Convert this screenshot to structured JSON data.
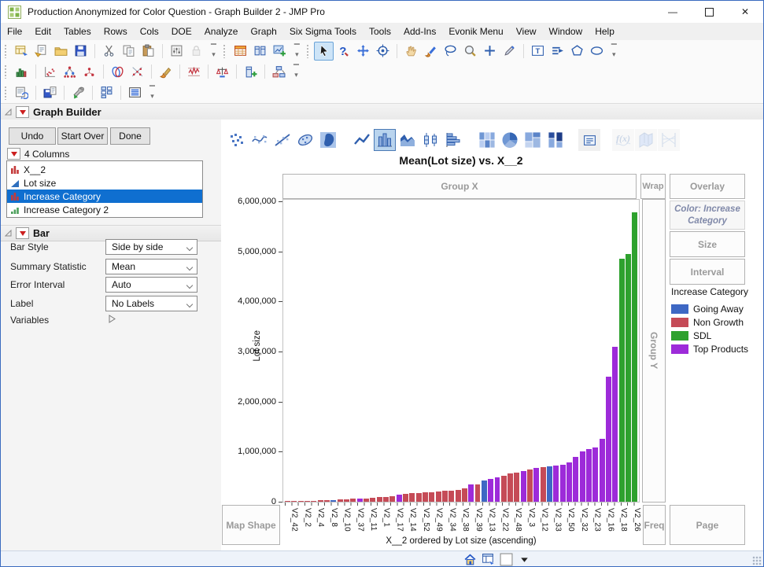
{
  "window": {
    "title": "Production Anonymized for Color Question - Graph Builder 2 - JMP Pro",
    "app_icon": "jmp-logo-icon"
  },
  "menu": {
    "items": [
      "File",
      "Edit",
      "Tables",
      "Rows",
      "Cols",
      "DOE",
      "Analyze",
      "Graph",
      "Six Sigma Tools",
      "Tools",
      "Add-Ins",
      "Evonik Menu",
      "View",
      "Window",
      "Help"
    ]
  },
  "toolbars": {
    "row1": [
      {
        "groups": [
          [
            "new-window",
            "open-script",
            "open-folder",
            "save"
          ],
          [
            "cut",
            "copy",
            "paste"
          ],
          [
            "preferences",
            "lock-disabled"
          ]
        ],
        "overflow": true
      },
      {
        "groups": [
          [
            "data-table",
            "columns",
            "new-graph"
          ]
        ],
        "overflow": true
      },
      {
        "groups": [
          [
            "cursor-selected",
            "help",
            "move",
            "target"
          ],
          [
            "hand",
            "brush",
            "lasso",
            "zoom",
            "crosshair",
            "annotate"
          ],
          [
            "text-box",
            "arrow-lines",
            "polygon",
            "oval"
          ]
        ],
        "overflow": true
      }
    ],
    "row2": [
      {
        "groups": [
          [
            "distribution"
          ],
          [
            "fit-y-by-x",
            "hierarchical-cluster",
            "cluster"
          ],
          [
            "matched-pairs",
            "fit-model"
          ],
          [
            "screening"
          ],
          [
            "control-chart"
          ],
          [
            "variability"
          ],
          [
            "cols-add"
          ],
          [
            "partition"
          ]
        ],
        "overflow": true
      }
    ],
    "row3": [
      {
        "groups": [
          [
            "data-refresh"
          ],
          [
            "save-session"
          ],
          [
            "run-tools"
          ],
          [
            "journal"
          ],
          [
            "layout-view"
          ]
        ],
        "overflow": true
      }
    ]
  },
  "graph_builder": {
    "outline_title": "Graph Builder",
    "buttons": [
      "Undo",
      "Start Over",
      "Done"
    ],
    "columns_header": "4 Columns",
    "columns": [
      {
        "label": "X__2",
        "icon": "red-bars-icon",
        "selected": false
      },
      {
        "label": "Lot size",
        "icon": "blue-triangle-icon",
        "selected": false
      },
      {
        "label": "Increase Category",
        "icon": "red-bars-icon",
        "selected": true
      },
      {
        "label": "Increase Category 2",
        "icon": "green-bars-icon",
        "selected": false
      }
    ],
    "bar_panel": {
      "title": "Bar",
      "rows": [
        {
          "label": "Bar Style",
          "value": "Side by side"
        },
        {
          "label": "Summary Statistic",
          "value": "Mean"
        },
        {
          "label": "Error Interval",
          "value": "Auto"
        },
        {
          "label": "Label",
          "value": "No Labels"
        }
      ],
      "variables_label": "Variables"
    },
    "palette": {
      "groups": [
        [
          "points",
          "smoother",
          "line-of-fit",
          "ellipse",
          "contour"
        ],
        [
          "line",
          "bar-selected",
          "area",
          "box-plot",
          "histogram"
        ],
        [
          "heatmap",
          "pie",
          "treemap",
          "mosaic"
        ],
        [
          "caption-box"
        ],
        [
          "formula-disabled",
          "map-shape-disabled",
          "parallel-disabled"
        ]
      ]
    }
  },
  "chart": {
    "title": "Mean(Lot size) vs. X__2",
    "zones": {
      "group_x": "Group X",
      "wrap": "Wrap",
      "overlay": "Overlay",
      "color": "Color: Increase Category",
      "size": "Size",
      "interval": "Interval",
      "group_y": "Group Y",
      "map_shape": "Map Shape",
      "freq": "Freq",
      "page": "Page"
    },
    "legend": {
      "title": "Increase Category",
      "items": [
        {
          "label": "Going Away",
          "color": "#3E68C4"
        },
        {
          "label": "Non Growth",
          "color": "#C54B57"
        },
        {
          "label": "SDL",
          "color": "#2EA12E"
        },
        {
          "label": "Top Products",
          "color": "#9D2BD9"
        }
      ]
    }
  },
  "chart_data": {
    "type": "bar",
    "title": "Mean(Lot size) vs. X__2",
    "xlabel": "X__2 ordered by Lot size (ascending)",
    "ylabel": "Lot size",
    "ylim": [
      0,
      6000000
    ],
    "grid": false,
    "legend_position": "right",
    "yticks": [
      0,
      1000000,
      2000000,
      3000000,
      4000000,
      5000000,
      6000000
    ],
    "ytick_labels": [
      "0",
      "1,000,000",
      "2,000,000",
      "3,000,000",
      "4,000,000",
      "5,000,000",
      "6,000,000"
    ],
    "x_tick_labels": [
      "V2_42",
      "V2_2",
      "V2_4",
      "V2_8",
      "V2_10",
      "V2_37",
      "V2_11",
      "V2_1",
      "V2_17",
      "V2_14",
      "V2_52",
      "V2_49",
      "V2_34",
      "V2_38",
      "V2_39",
      "V2_13",
      "V2_22",
      "V2_48",
      "V2_3",
      "V2_12",
      "V2_33",
      "V2_50",
      "V2_32",
      "V2_23",
      "V2_16",
      "V2_18",
      "V2_26"
    ],
    "category_colors": {
      "GA": "#3E68C4",
      "NG": "#C54B57",
      "SDL": "#2EA12E",
      "TP": "#9D2BD9"
    },
    "category_names": {
      "GA": "Going Away",
      "NG": "Non Growth",
      "SDL": "SDL",
      "TP": "Top Products"
    },
    "bars": [
      {
        "v": 8000,
        "c": "NG"
      },
      {
        "v": 10000,
        "c": "NG"
      },
      {
        "v": 13000,
        "c": "NG"
      },
      {
        "v": 16000,
        "c": "NG"
      },
      {
        "v": 20000,
        "c": "NG"
      },
      {
        "v": 24000,
        "c": "NG"
      },
      {
        "v": 30000,
        "c": "NG"
      },
      {
        "v": 38000,
        "c": "GA"
      },
      {
        "v": 42000,
        "c": "NG"
      },
      {
        "v": 48000,
        "c": "NG"
      },
      {
        "v": 55000,
        "c": "NG"
      },
      {
        "v": 62000,
        "c": "TP"
      },
      {
        "v": 70000,
        "c": "NG"
      },
      {
        "v": 80000,
        "c": "NG"
      },
      {
        "v": 90000,
        "c": "NG"
      },
      {
        "v": 100000,
        "c": "NG"
      },
      {
        "v": 115000,
        "c": "NG"
      },
      {
        "v": 140000,
        "c": "TP"
      },
      {
        "v": 155000,
        "c": "NG"
      },
      {
        "v": 165000,
        "c": "NG"
      },
      {
        "v": 175000,
        "c": "NG"
      },
      {
        "v": 185000,
        "c": "NG"
      },
      {
        "v": 195000,
        "c": "NG"
      },
      {
        "v": 205000,
        "c": "NG"
      },
      {
        "v": 215000,
        "c": "NG"
      },
      {
        "v": 225000,
        "c": "NG"
      },
      {
        "v": 240000,
        "c": "NG"
      },
      {
        "v": 260000,
        "c": "NG"
      },
      {
        "v": 340000,
        "c": "TP"
      },
      {
        "v": 350000,
        "c": "NG"
      },
      {
        "v": 420000,
        "c": "GA"
      },
      {
        "v": 450000,
        "c": "TP"
      },
      {
        "v": 480000,
        "c": "TP"
      },
      {
        "v": 520000,
        "c": "NG"
      },
      {
        "v": 560000,
        "c": "NG"
      },
      {
        "v": 580000,
        "c": "NG"
      },
      {
        "v": 610000,
        "c": "TP"
      },
      {
        "v": 640000,
        "c": "NG"
      },
      {
        "v": 670000,
        "c": "TP"
      },
      {
        "v": 690000,
        "c": "NG"
      },
      {
        "v": 710000,
        "c": "GA"
      },
      {
        "v": 730000,
        "c": "TP"
      },
      {
        "v": 740000,
        "c": "TP"
      },
      {
        "v": 780000,
        "c": "TP"
      },
      {
        "v": 900000,
        "c": "TP"
      },
      {
        "v": 1000000,
        "c": "TP"
      },
      {
        "v": 1050000,
        "c": "TP"
      },
      {
        "v": 1080000,
        "c": "TP"
      },
      {
        "v": 1250000,
        "c": "TP"
      },
      {
        "v": 2500000,
        "c": "TP"
      },
      {
        "v": 3100000,
        "c": "TP"
      },
      {
        "v": 4850000,
        "c": "SDL"
      },
      {
        "v": 4950000,
        "c": "SDL"
      },
      {
        "v": 5780000,
        "c": "SDL"
      }
    ]
  },
  "status_bar": {
    "icons": [
      "home-icon",
      "window-list-icon",
      "color-chip",
      "caret-down-icon"
    ]
  }
}
